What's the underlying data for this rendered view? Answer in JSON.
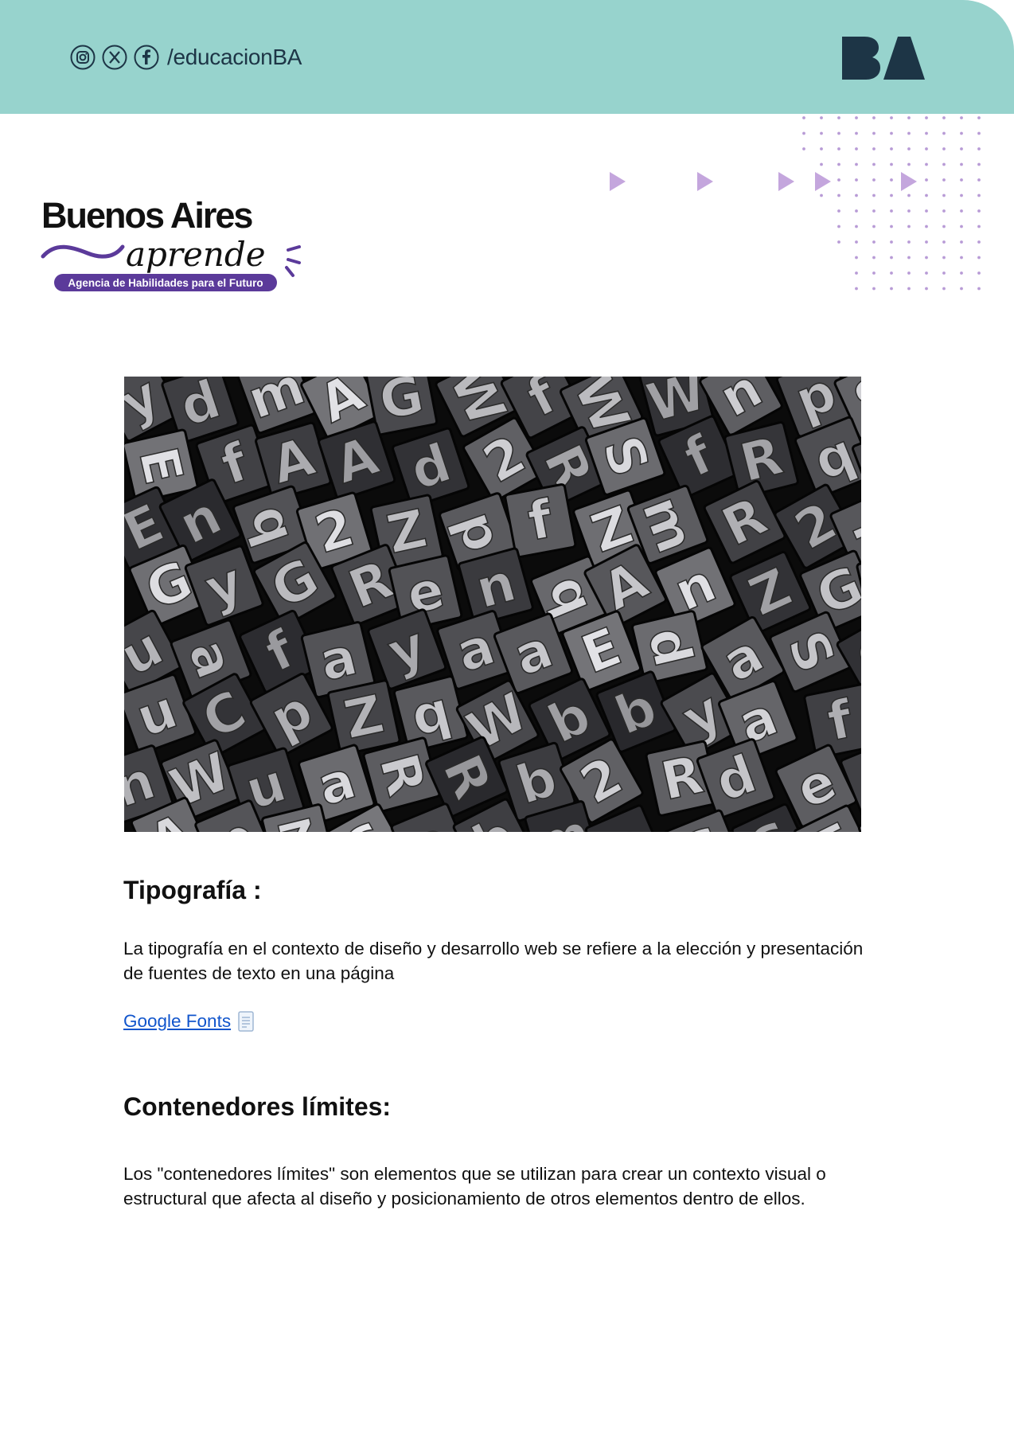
{
  "header": {
    "social_icons": [
      "instagram-icon",
      "x-icon",
      "facebook-icon"
    ],
    "social_handle": "/educacionBA",
    "ba_logo_text": "BA",
    "band_color": "#97d3cd"
  },
  "brand": {
    "line1": "Buenos Aires",
    "line2": "aprende",
    "tagline": "Agencia de Habilidades para el Futuro",
    "accent_color": "#5b3a9a"
  },
  "decoration": {
    "dot_color": "#b89bd6",
    "arrow_color": "#c4a6dd"
  },
  "hero_image": {
    "description_icon": "letterpress-type-photo"
  },
  "sections": [
    {
      "title": "Tipografía :",
      "body": "La tipografía en el contexto de diseño y desarrollo web se refiere a la elección y presentación de fuentes de texto en una página",
      "link_label": "Google Fonts",
      "link_icon": "document-icon"
    },
    {
      "title": "Contenedores límites:",
      "body": "Los \"contenedores límites\" son elementos que se utilizan para crear un contexto visual o estructural que afecta al diseño y posicionamiento de otros elementos dentro de ellos."
    }
  ]
}
